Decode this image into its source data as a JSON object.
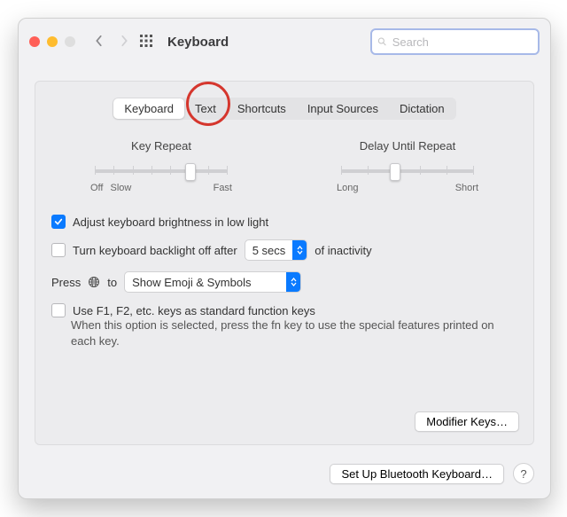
{
  "toolbar": {
    "title": "Keyboard",
    "search_placeholder": "Search"
  },
  "tabs": {
    "items": [
      "Keyboard",
      "Text",
      "Shortcuts",
      "Input Sources",
      "Dictation"
    ],
    "active_index": 0,
    "circled_index": 1
  },
  "sliders": {
    "key_repeat": {
      "label": "Key Repeat",
      "left1": "Off",
      "left2": "Slow",
      "right": "Fast",
      "ticks": 8,
      "value_index": 5
    },
    "delay": {
      "label": "Delay Until Repeat",
      "left": "Long",
      "right": "Short",
      "ticks": 6,
      "value_index": 2
    }
  },
  "options": {
    "brightness": {
      "checked": true,
      "label": "Adjust keyboard brightness in low light"
    },
    "backlight": {
      "checked": false,
      "prefix": "Turn keyboard backlight off after",
      "select": "5 secs",
      "suffix": "of inactivity"
    },
    "globe": {
      "prefix": "Press",
      "mid": "to",
      "select": "Show Emoji & Symbols"
    },
    "fnkeys": {
      "checked": false,
      "label": "Use F1, F2, etc. keys as standard function keys",
      "note": "When this option is selected, press the fn key to use the special features printed on each key."
    }
  },
  "buttons": {
    "modifier": "Modifier Keys…",
    "bluetooth": "Set Up Bluetooth Keyboard…",
    "help": "?"
  }
}
